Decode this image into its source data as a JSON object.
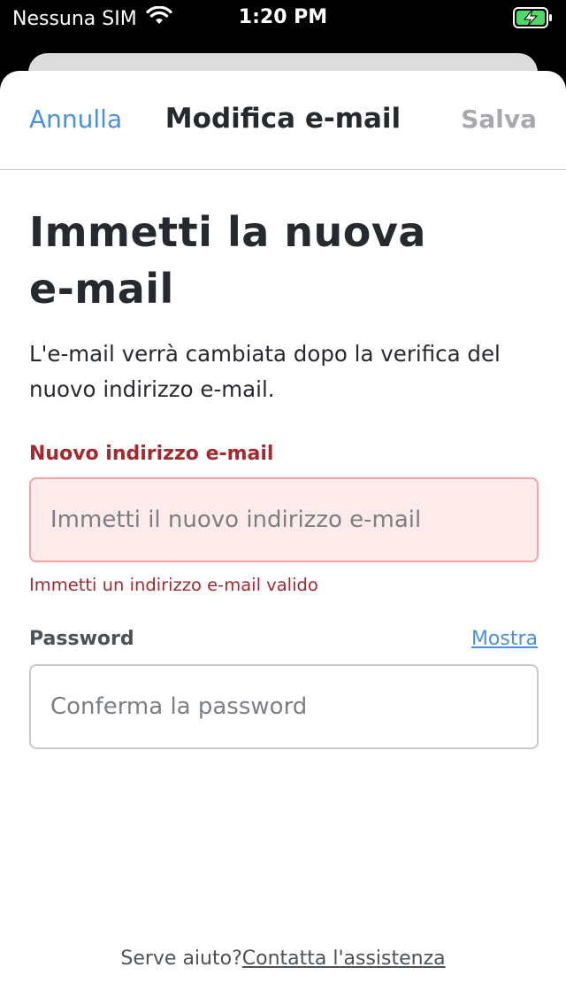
{
  "status_bar": {
    "carrier": "Nessuna SIM",
    "time": "1:20 PM",
    "icons": [
      "wifi-icon",
      "battery-charging-icon"
    ]
  },
  "nav": {
    "cancel_label": "Annulla",
    "title": "Modifica e-mail",
    "save_label": "Salva"
  },
  "form": {
    "heading_line1": "Immetti la nuova",
    "heading_line2": "e-mail",
    "description": "L'e-mail verrà cambiata dopo la verifica del nuovo indirizzo e-mail.",
    "email": {
      "label": "Nuovo indirizzo e-mail",
      "placeholder": "Immetti il nuovo indirizzo e-mail",
      "value": "",
      "error": "Immetti un indirizzo e-mail valido"
    },
    "password": {
      "label": "Password",
      "show_label": "Mostra",
      "placeholder": "Conferma la password",
      "value": ""
    }
  },
  "help": {
    "prompt": "Serve aiuto?",
    "link": "Contatta l'assistenza"
  },
  "colors": {
    "accent": "#4a90e2",
    "error": "#a4282e",
    "error_bg": "#fcebea",
    "error_border": "#f2a2a2",
    "text": "#262a2f",
    "disabled": "#a7a9ac"
  }
}
